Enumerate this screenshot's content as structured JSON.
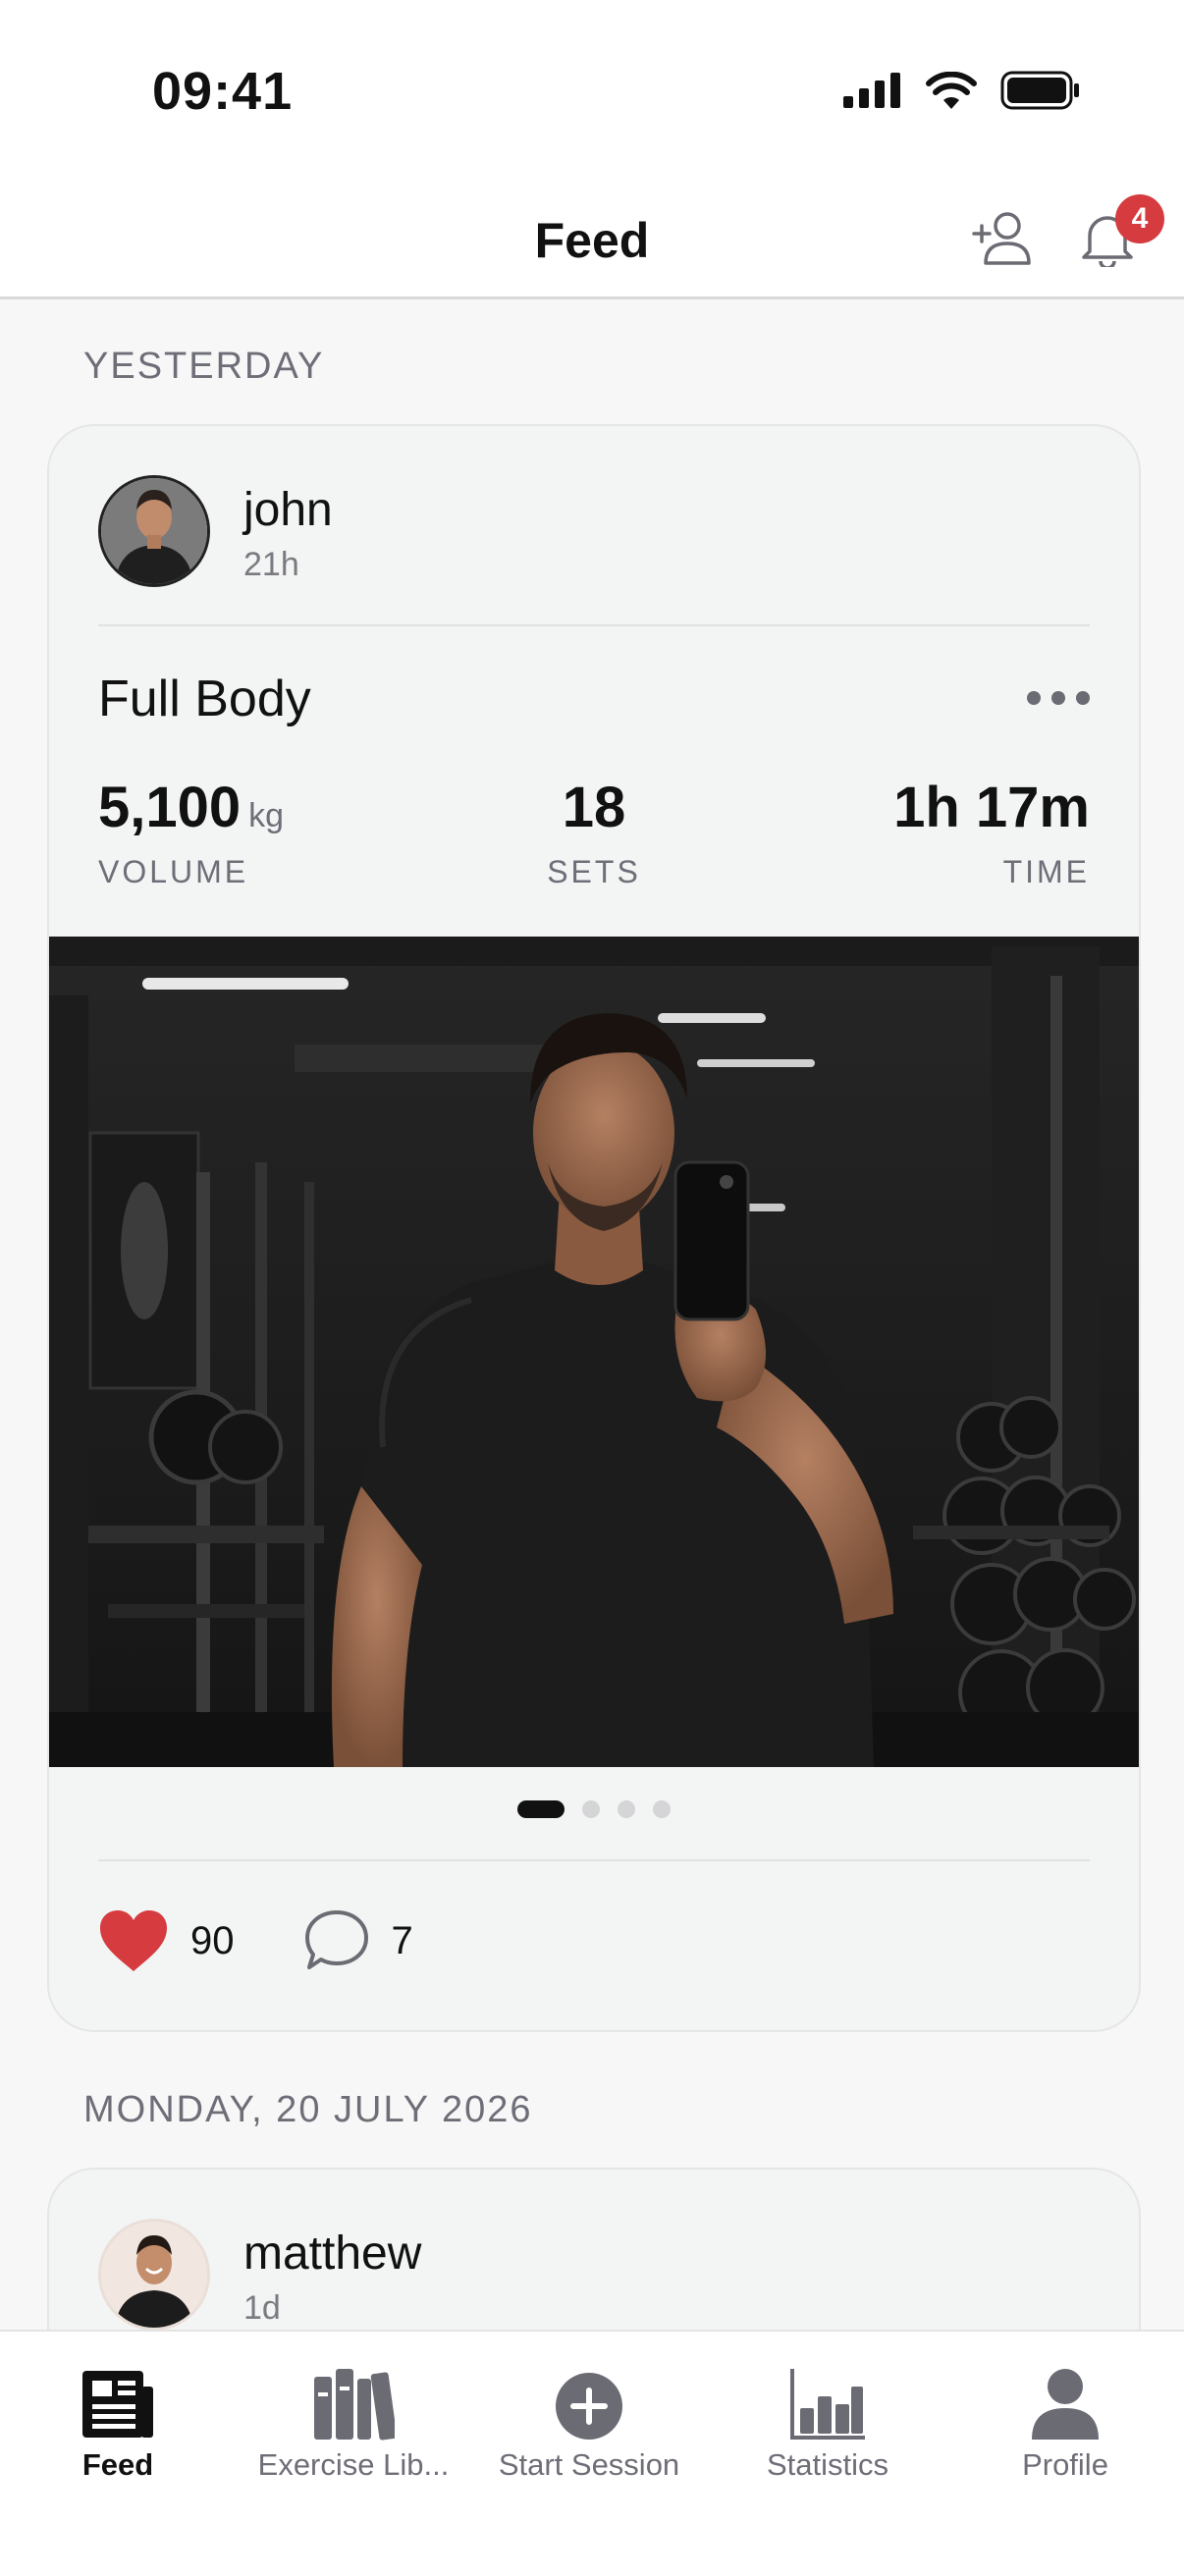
{
  "status_bar": {
    "time": "09:41"
  },
  "header": {
    "title": "Feed",
    "notification_count": "4"
  },
  "sections": [
    {
      "label": "YESTERDAY"
    },
    {
      "label": "MONDAY, 20 JULY 2026"
    }
  ],
  "posts": [
    {
      "username": "john",
      "time_ago": "21h",
      "workout_title": "Full Body",
      "stats": {
        "volume_value": "5,100",
        "volume_unit": "kg",
        "volume_label": "VOLUME",
        "sets_value": "18",
        "sets_label": "SETS",
        "time_value": "1h 17m",
        "time_label": "TIME"
      },
      "photo_pages": 4,
      "photo_current": 1,
      "likes": "90",
      "comments": "7"
    },
    {
      "username": "matthew",
      "time_ago": "1d"
    }
  ],
  "tabbar": {
    "items": [
      {
        "label": "Feed",
        "icon": "feed-icon",
        "active": true
      },
      {
        "label": "Exercise Lib...",
        "icon": "library-icon",
        "active": false
      },
      {
        "label": "Start Session",
        "icon": "plus-circle-icon",
        "active": false
      },
      {
        "label": "Statistics",
        "icon": "bar-chart-icon",
        "active": false
      },
      {
        "label": "Profile",
        "icon": "person-icon",
        "active": false
      }
    ]
  },
  "colors": {
    "accent_red": "#d53b3f",
    "muted_text": "#6e6e78",
    "icon_gray": "#6b6b73"
  }
}
